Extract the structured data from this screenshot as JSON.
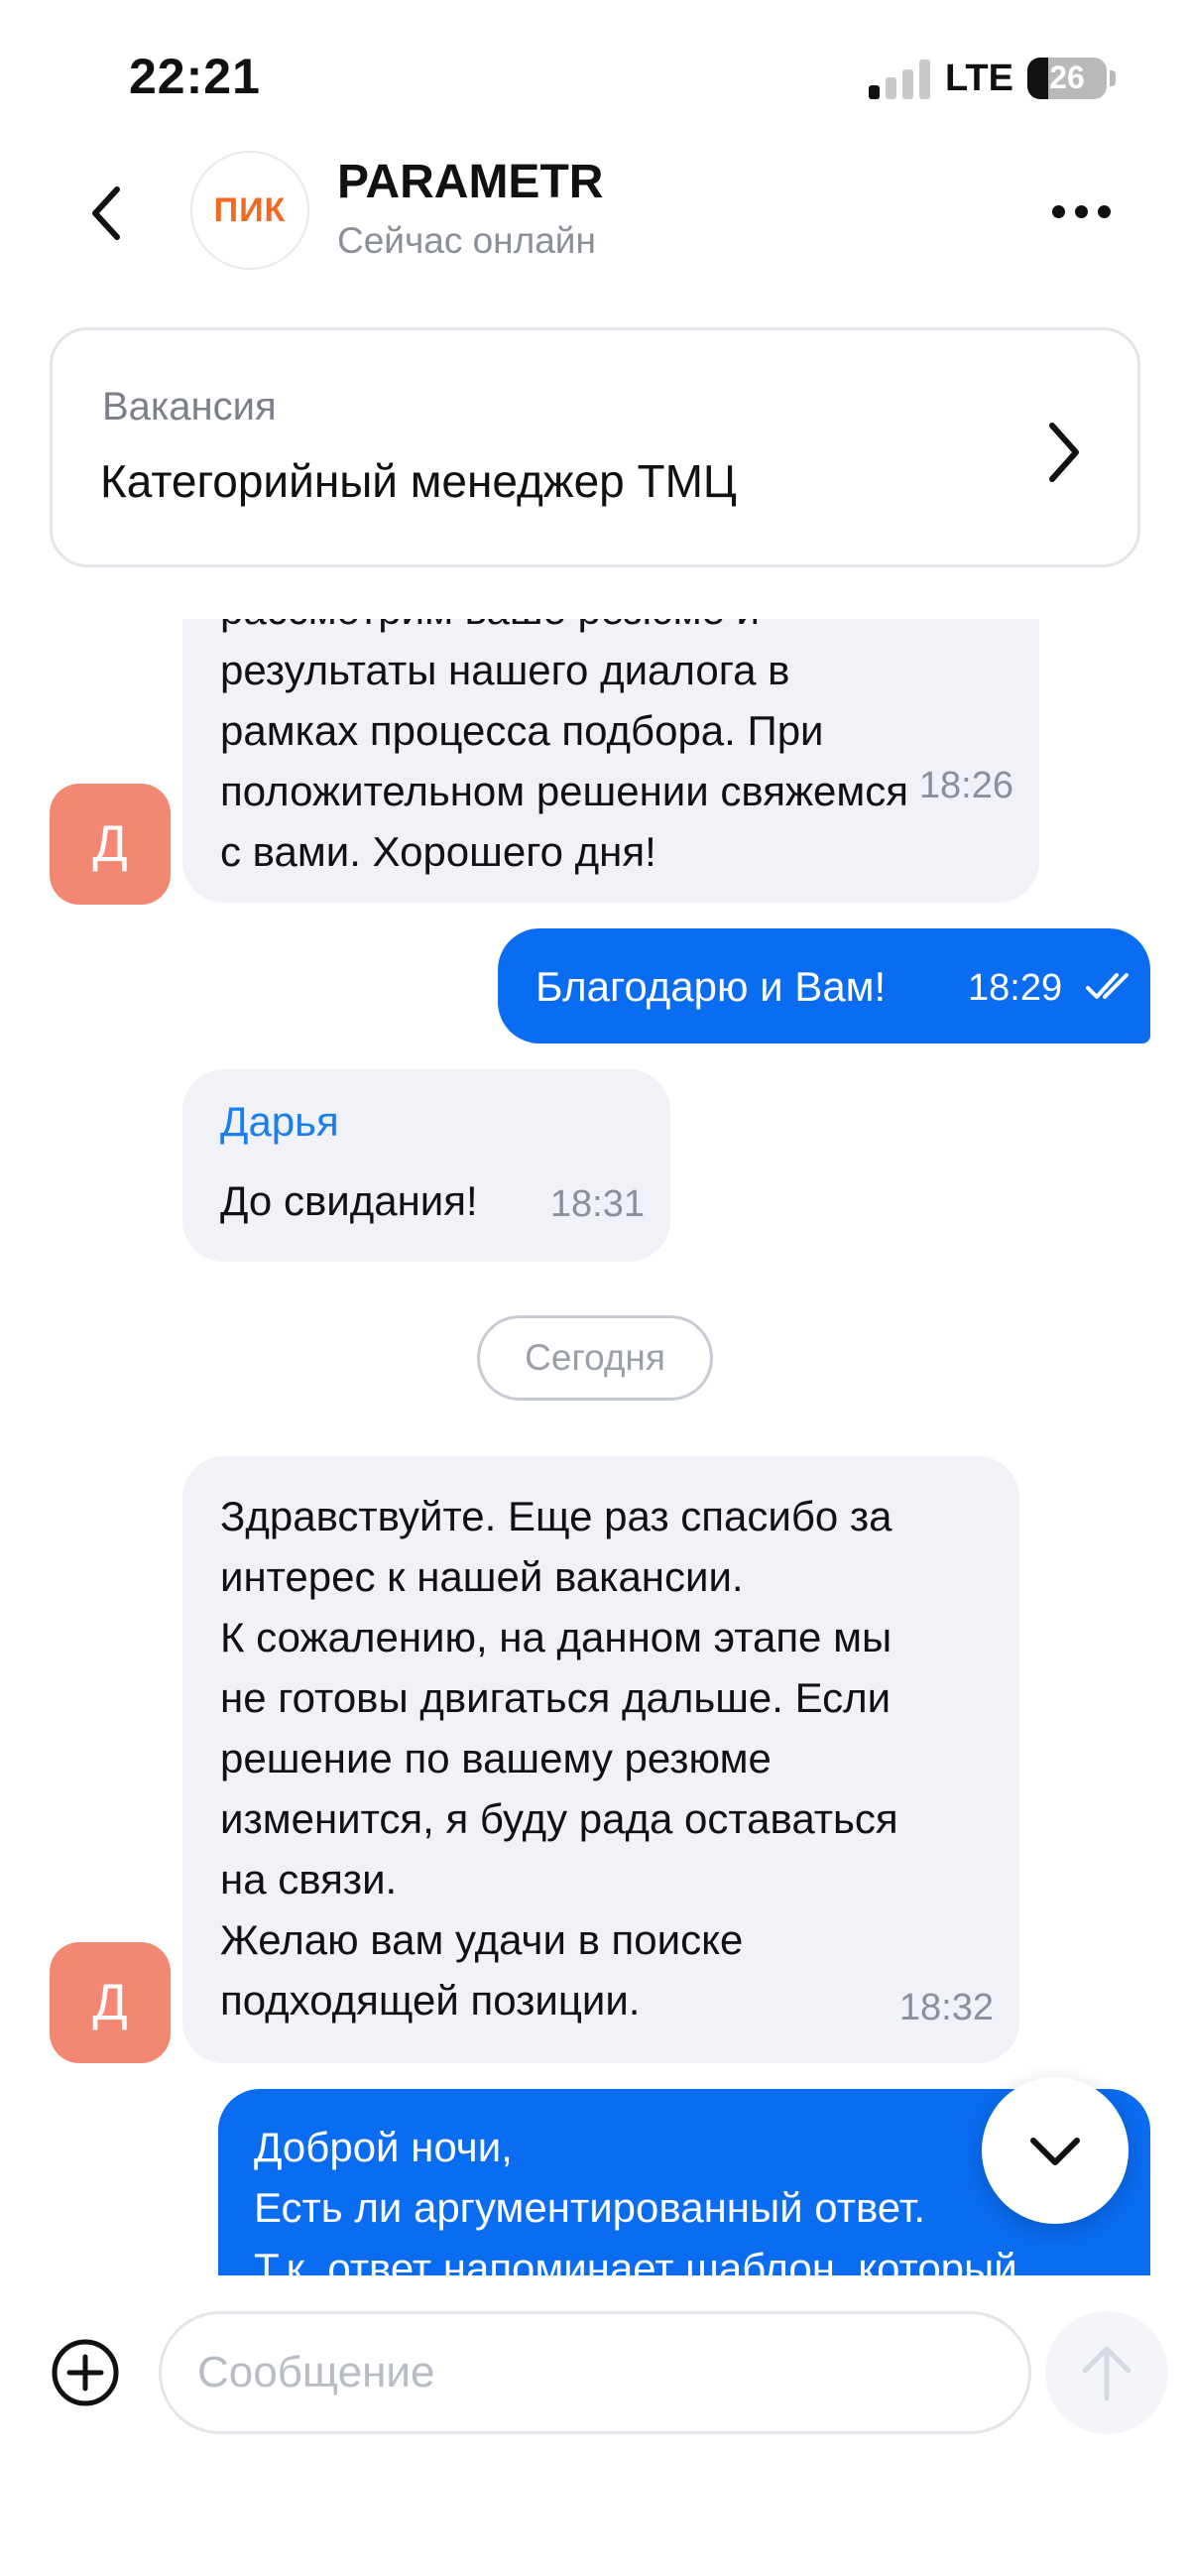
{
  "status_bar": {
    "time": "22:21",
    "network": "LTE",
    "battery": "26",
    "battery_level": 0.26
  },
  "header": {
    "back_icon": "chevron-left-icon",
    "logo_text": "ПИК",
    "title": "PARAMETR",
    "status": "Сейчас онлайн",
    "more_icon": "more-horizontal-icon"
  },
  "vacancy": {
    "label": "Вакансия",
    "name": "Категорийный менеджер ТМЦ",
    "chevron_icon": "chevron-right-icon"
  },
  "messages": [
    {
      "direction": "incoming",
      "avatar": "Д",
      "partial_top": "рассмотрим ваше резюме и",
      "text": "результаты нашего диалога в\nрамках процесса подбора. При\nположительном решении свяжемся\nс вами. Хорошего дня!",
      "time": "18:26"
    },
    {
      "direction": "outgoing",
      "text": "Благодарю и Вам!",
      "time": "18:29",
      "read_icon": "double-check-icon"
    },
    {
      "direction": "incoming",
      "sender": "Дарья",
      "text": "До свидания!",
      "time": "18:31"
    },
    {
      "direction": "incoming",
      "avatar": "Д",
      "text": "Здравствуйте. Еще раз спасибо за\nинтерес к нашей вакансии.\nК сожалению, на данном этапе мы\nне готовы двигаться дальше. Если\nрешение по вашему резюме\nизменится, я буду рада оставаться\nна связи.\nЖелаю вам удачи в поиске\nподходящей позиции.",
      "time": "18:32"
    },
    {
      "direction": "outgoing",
      "text": "Доброй ночи,\nЕсть ли аргументированный ответ.\nТ.к. ответ напоминает шаблон, который"
    }
  ],
  "date_separator": "Сегодня",
  "scroll_down_icon": "chevron-down-icon",
  "composer": {
    "attach_icon": "plus-circle-icon",
    "placeholder": "Сообщение",
    "send_icon": "arrow-up-icon"
  },
  "colors": {
    "accent": "#0a6cf0",
    "incoming_bubble": "#f1f2f7",
    "avatar": "#f28872",
    "logo": "#f26a21"
  }
}
